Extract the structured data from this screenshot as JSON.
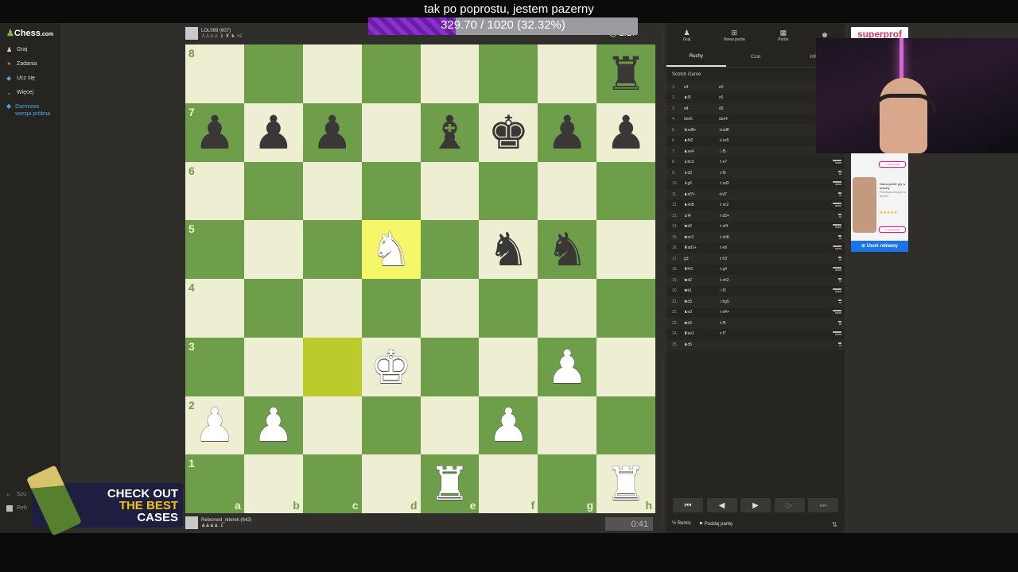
{
  "overlay": {
    "title": "tak po poprostu, jestem pazerny",
    "goal_text": "329.70 / 1020 (32.32%)",
    "goal_fraction": 0.3232
  },
  "sidebar": {
    "logo": "Chess",
    "logo_suffix": ".com",
    "items": [
      {
        "label": "Graj",
        "icon": "play-icon"
      },
      {
        "label": "Zadania",
        "icon": "puzzle-icon"
      },
      {
        "label": "Ucz się",
        "icon": "learn-icon"
      },
      {
        "label": "Więcej",
        "icon": "more-icon"
      }
    ],
    "cta": "Darmowa wersja próbna",
    "search_label": "Szu",
    "user_label": "Reb"
  },
  "players": {
    "top": {
      "name": "LOL099",
      "rating": "(607)",
      "extra": "+2",
      "clock": "2:17"
    },
    "bottom": {
      "name": "Reborned_niterek",
      "rating": "(642)",
      "clock": "0:41"
    }
  },
  "board": {
    "ranks": [
      "8",
      "7",
      "6",
      "5",
      "4",
      "3",
      "2",
      "1"
    ],
    "files": [
      "a",
      "b",
      "c",
      "d",
      "e",
      "f",
      "g",
      "h"
    ],
    "highlights": [
      "d5",
      "c3"
    ],
    "pieces": {
      "h8": "bR",
      "a7": "bP",
      "b7": "bP",
      "c7": "bP",
      "e7": "bB",
      "f7": "bK",
      "g7": "bP",
      "h7": "bP",
      "d5": "wN",
      "f5": "bN",
      "g5": "bN",
      "d3": "wK",
      "g3": "wP",
      "a2": "wP",
      "b2": "wP",
      "f2": "wP",
      "e1": "wR",
      "h1": "wR"
    }
  },
  "panel": {
    "top_icons": [
      {
        "label": "Graj",
        "icon": "play-icon"
      },
      {
        "label": "Nowa partia",
        "icon": "new-game-icon"
      },
      {
        "label": "Partie",
        "icon": "games-icon"
      },
      {
        "label": "",
        "icon": "friends-icon"
      }
    ],
    "tabs": [
      "Ruchy",
      "Czat",
      "Infor"
    ],
    "opening": "Scotch Game",
    "moves": [
      {
        "no": "1.",
        "w": "e4",
        "b": "e5"
      },
      {
        "no": "2.",
        "w": "♞f3",
        "b": "c6"
      },
      {
        "no": "3.",
        "w": "d4",
        "b": "d5"
      },
      {
        "no": "4.",
        "w": "dxe5",
        "b": "dxe4"
      },
      {
        "no": "5.",
        "w": "♛xd8+",
        "b": "♔xd8"
      },
      {
        "no": "6.",
        "w": "♞fd2",
        "b": "♕xe5"
      },
      {
        "no": "7.",
        "w": "♞xe4",
        "b": "♘f5"
      },
      {
        "no": "8.",
        "w": "♝bc3",
        "b": "♗e7"
      },
      {
        "no": "9.",
        "w": "♝d3",
        "b": "♗f6"
      },
      {
        "no": "10.",
        "w": "♝g5",
        "b": "♗xd3"
      },
      {
        "no": "11.",
        "w": "♞xf7+",
        "b": "♔d7"
      },
      {
        "no": "12.",
        "w": "♞xh8",
        "b": "♗xc2"
      },
      {
        "no": "13.",
        "w": "♝f4",
        "b": "♗d3+"
      },
      {
        "no": "14.",
        "w": "♚d2",
        "b": "♗xf4"
      },
      {
        "no": "15.",
        "w": "♚xc2",
        "b": "♗xh8"
      },
      {
        "no": "16.",
        "w": "♜ad1+",
        "b": "♗e8"
      },
      {
        "no": "17.",
        "w": "g3",
        "b": "♗h3"
      },
      {
        "no": "18.",
        "w": "♜hf1",
        "b": "♗g4"
      },
      {
        "no": "19.",
        "w": "♚d2",
        "b": "♗xh2"
      },
      {
        "no": "20.",
        "w": "♚b1",
        "b": "♘f3"
      },
      {
        "no": "21.",
        "w": "♚d3",
        "b": "♘hg5"
      },
      {
        "no": "22.",
        "w": "♞e3",
        "b": "♗d4+"
      },
      {
        "no": "23.",
        "w": "♚d3",
        "b": "♗f5"
      },
      {
        "no": "24.",
        "w": "♜ee1",
        "b": "♗f7"
      },
      {
        "no": "25.",
        "w": "♞d5",
        "b": ""
      }
    ],
    "footer_draw": "Remis",
    "footer_resign": "Poddaj partię"
  },
  "ads": {
    "top_brand": "superprof",
    "side_headline": "Nauczyciele gry w szachy",
    "side_sub": "Pierwsza lekcja za darmo",
    "side_btn": "1. lekcja gratis",
    "side_stars": "★★★★★",
    "remove": "Usuń reklamy",
    "banner_line1": "CHECK OUT",
    "banner_line2": "THE BEST",
    "banner_line3": "CASES"
  },
  "colors": {
    "board_light": "#eeeed2",
    "board_dark": "#6e9e4a",
    "highlight": "#f6f669",
    "goal_fill": "#8a2fd0",
    "panel_bg": "#262421"
  }
}
